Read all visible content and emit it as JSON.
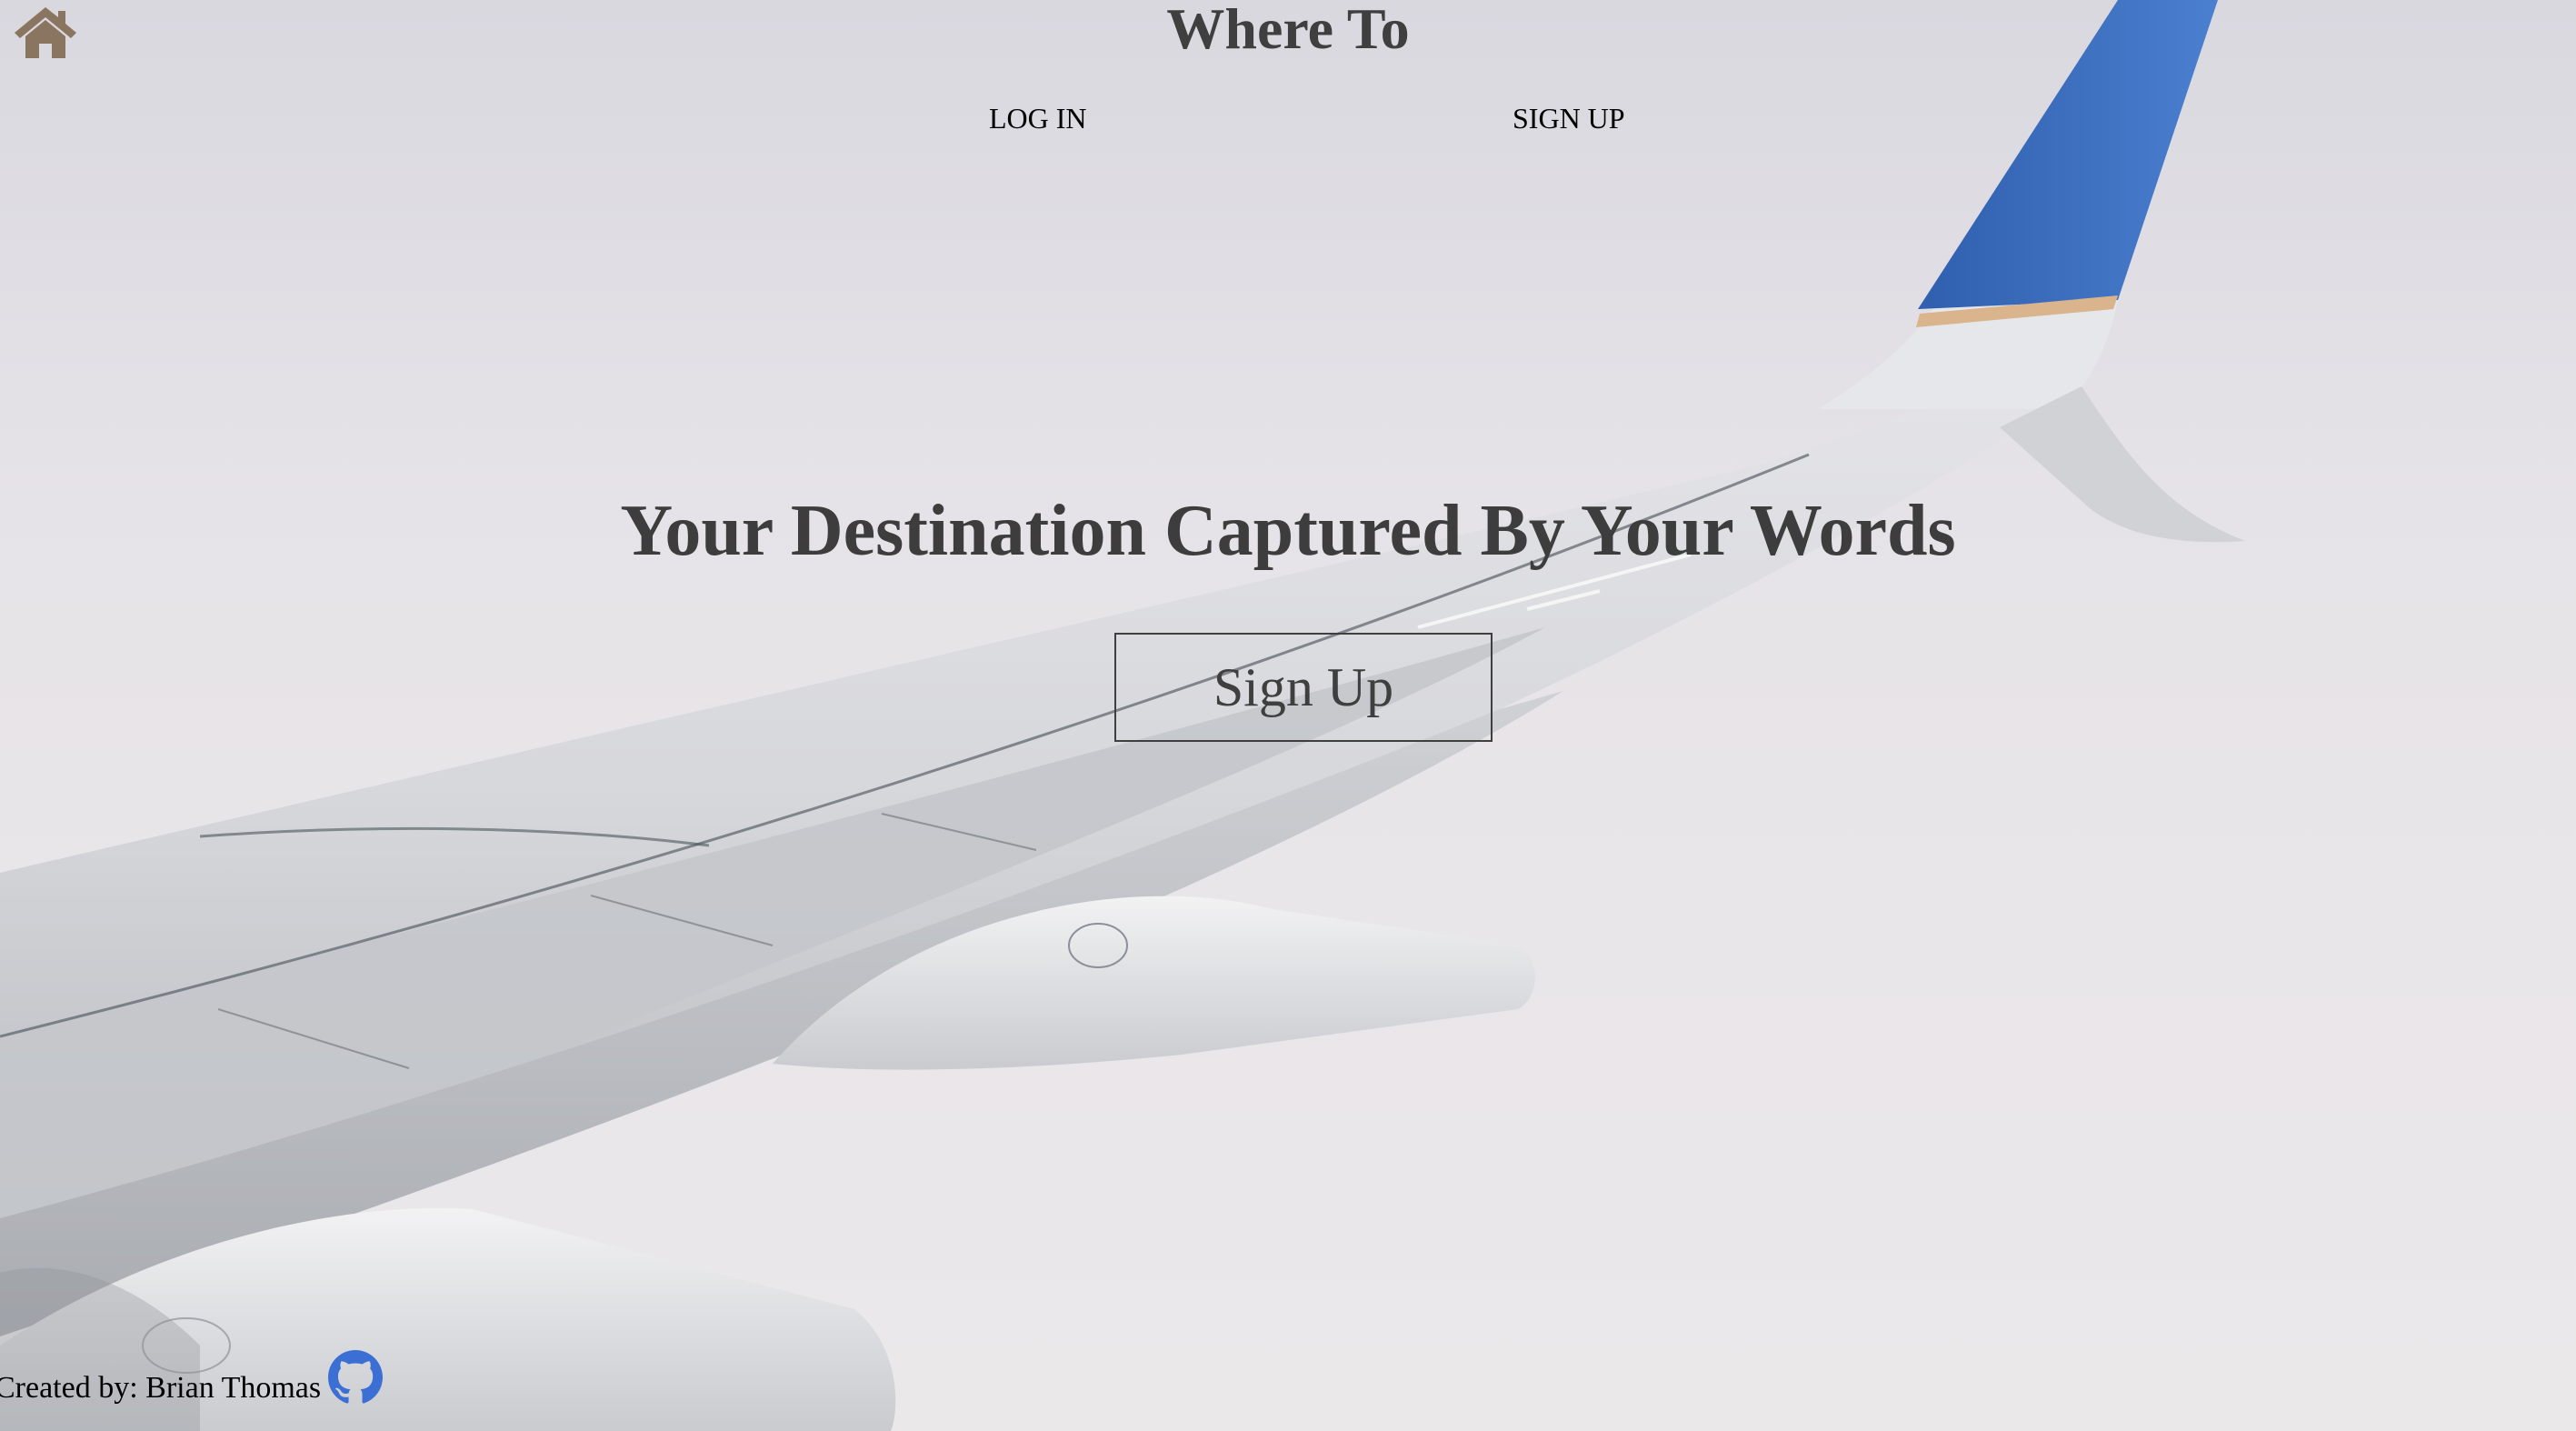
{
  "header": {
    "title": "Where To",
    "home_icon": "home-icon"
  },
  "nav": {
    "login_label": "LOG IN",
    "signup_label": "SIGN UP"
  },
  "hero": {
    "heading": "Your Destination Captured By Your Words",
    "button_label": "Sign Up",
    "background": "airplane-wing-over-clouds"
  },
  "footer": {
    "credit": "Created by: Brian Thomas",
    "github_icon": "github-icon"
  },
  "colors": {
    "home_icon": "#8a7560",
    "github_icon": "#3b6fd4",
    "wingtip_blue": "#3f73c4",
    "text_dark": "#3f3f3f"
  }
}
